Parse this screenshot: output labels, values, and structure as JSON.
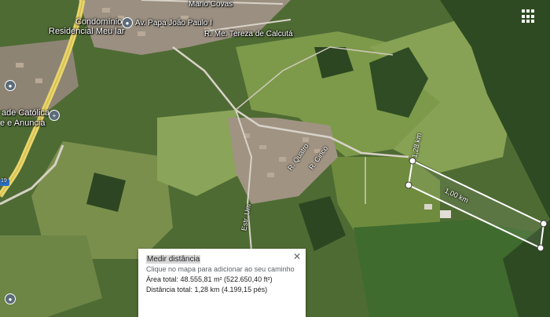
{
  "map": {
    "type": "satellite",
    "labels": {
      "neighborhood": "Mario Covas",
      "condominium_1": "Condomínio",
      "condominium_2": "Residencial Meu lar",
      "street_papa": "Av. Papa João Paulo I",
      "street_madre": "R. Me. Tereza de Calcutá",
      "church_1": "ade Católica",
      "church_2": "e e Anuncia",
      "street_quatro": "R. Quatro",
      "street_cinco": "R. Cinco",
      "street_estr": "Estr. Um",
      "route_shield": "19"
    }
  },
  "measurement": {
    "segment_1": "1,28 km",
    "segment_2": "1,00 km"
  },
  "panel": {
    "title": "Medir distância",
    "hint": "Clique no mapa para adicionar ao seu caminho",
    "area": "Área total: 48.555,81 m² (522.650,40 ft²)",
    "distance": "Distância total: 1,28 km (4.199,15 pés)",
    "close_symbol": "✕"
  },
  "icons": {
    "apps": "apps-grid-icon",
    "close": "close-icon",
    "poi": "place-pin-icon"
  }
}
